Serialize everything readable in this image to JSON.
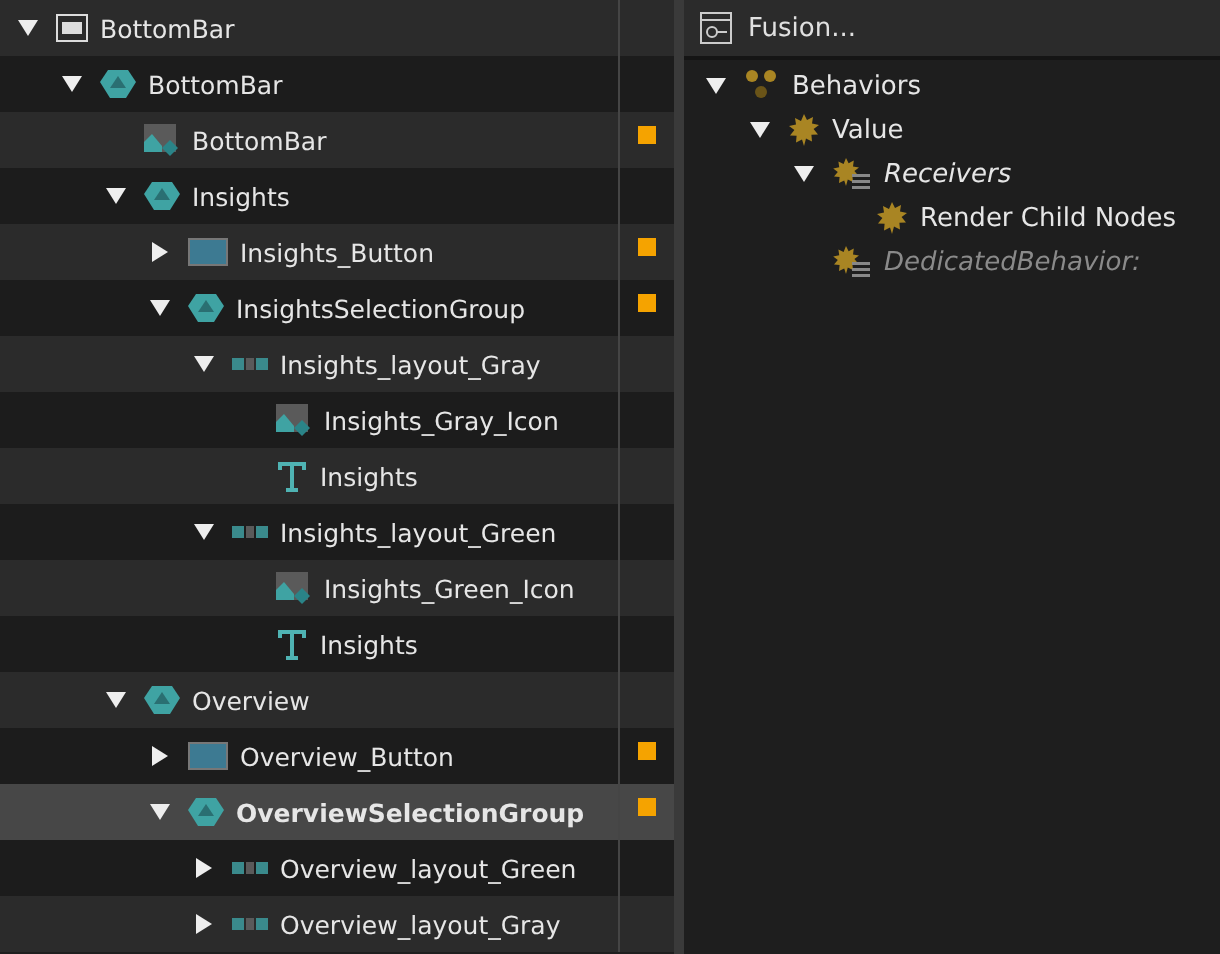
{
  "hierarchy": [
    {
      "label": "BottomBar",
      "kind": "screen",
      "expanded": true,
      "marked": false,
      "selected": false,
      "children": [
        {
          "label": "BottomBar",
          "kind": "group",
          "expanded": true,
          "marked": false,
          "selected": false,
          "children": [
            {
              "label": "BottomBar",
              "kind": "image",
              "marked": true,
              "selected": false
            },
            {
              "label": "Insights",
              "kind": "group",
              "expanded": true,
              "marked": false,
              "selected": false,
              "children": [
                {
                  "label": "Insights_Button",
                  "kind": "button",
                  "expanded": false,
                  "marked": true,
                  "selected": false
                },
                {
                  "label": "InsightsSelectionGroup",
                  "kind": "group",
                  "expanded": true,
                  "marked": true,
                  "selected": false,
                  "children": [
                    {
                      "label": "Insights_layout_Gray",
                      "kind": "layout",
                      "expanded": true,
                      "marked": false,
                      "selected": false,
                      "children": [
                        {
                          "label": "Insights_Gray_Icon",
                          "kind": "image",
                          "marked": false,
                          "selected": false
                        },
                        {
                          "label": "Insights",
                          "kind": "text",
                          "marked": false,
                          "selected": false
                        }
                      ]
                    },
                    {
                      "label": "Insights_layout_Green",
                      "kind": "layout",
                      "expanded": true,
                      "marked": false,
                      "selected": false,
                      "children": [
                        {
                          "label": "Insights_Green_Icon",
                          "kind": "image",
                          "marked": false,
                          "selected": false
                        },
                        {
                          "label": "Insights",
                          "kind": "text",
                          "marked": false,
                          "selected": false
                        }
                      ]
                    }
                  ]
                }
              ]
            },
            {
              "label": "Overview",
              "kind": "group",
              "expanded": true,
              "marked": false,
              "selected": false,
              "children": [
                {
                  "label": "Overview_Button",
                  "kind": "button",
                  "expanded": false,
                  "marked": true,
                  "selected": false
                },
                {
                  "label": "OverviewSelectionGroup",
                  "kind": "group",
                  "expanded": true,
                  "marked": true,
                  "selected": true,
                  "children": [
                    {
                      "label": "Overview_layout_Green",
                      "kind": "layout",
                      "expanded": false,
                      "marked": false,
                      "selected": false
                    },
                    {
                      "label": "Overview_layout_Gray",
                      "kind": "layout",
                      "expanded": false,
                      "marked": false,
                      "selected": false
                    }
                  ]
                }
              ]
            }
          ]
        }
      ]
    }
  ],
  "inspector": {
    "title": "Fusion...",
    "tree": [
      {
        "label": "Behaviors",
        "kind": "group",
        "expanded": true,
        "disabled": false,
        "children": [
          {
            "label": "Value",
            "kind": "behavior",
            "expanded": true,
            "disabled": false,
            "children": [
              {
                "label": "Receivers",
                "kind": "property",
                "expanded": true,
                "disabled": false,
                "children": [
                  {
                    "label": "Render Child Nodes",
                    "kind": "behavior",
                    "disabled": false
                  }
                ]
              },
              {
                "label": "DedicatedBehavior:",
                "kind": "property",
                "disabled": true
              }
            ]
          }
        ]
      }
    ]
  }
}
